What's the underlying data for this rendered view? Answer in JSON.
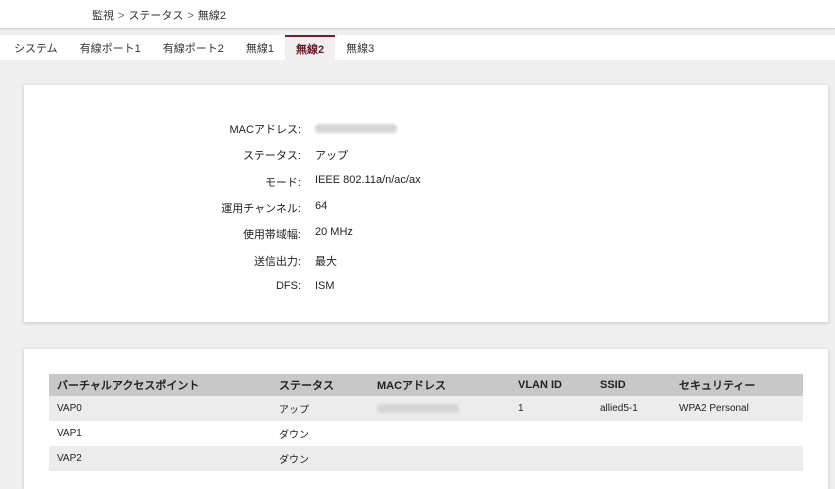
{
  "breadcrumb": {
    "items": [
      "監視",
      "ステータス",
      "無線2"
    ],
    "separator": ">"
  },
  "tabs": [
    {
      "label": "システム",
      "active": false
    },
    {
      "label": "有線ポート1",
      "active": false
    },
    {
      "label": "有線ポート2",
      "active": false
    },
    {
      "label": "無線1",
      "active": false
    },
    {
      "label": "無線2",
      "active": true
    },
    {
      "label": "無線3",
      "active": false
    }
  ],
  "info": {
    "mac_label": "MACアドレス:",
    "mac_value": "",
    "status_label": "ステータス:",
    "status_value": "アップ",
    "mode_label": "モード:",
    "mode_value": "IEEE 802.11a/n/ac/ax",
    "channel_label": "運用チャンネル:",
    "channel_value": "64",
    "bandwidth_label": "使用帯域幅:",
    "bandwidth_value": "20 MHz",
    "power_label": "送信出力:",
    "power_value": "最大",
    "dfs_label": "DFS:",
    "dfs_value": "ISM"
  },
  "vap_table": {
    "headers": [
      "バーチャルアクセスポイント",
      "ステータス",
      "MACアドレス",
      "VLAN ID",
      "SSID",
      "セキュリティー"
    ],
    "rows": [
      {
        "name": "VAP0",
        "status": "アップ",
        "mac": "",
        "vlan": "1",
        "ssid": "allied5-1",
        "security": "WPA2 Personal"
      },
      {
        "name": "VAP1",
        "status": "ダウン",
        "mac": "",
        "vlan": "",
        "ssid": "",
        "security": ""
      },
      {
        "name": "VAP2",
        "status": "ダウン",
        "mac": "",
        "vlan": "",
        "ssid": "",
        "security": ""
      }
    ]
  },
  "colors": {
    "active_tab": "#6b1a2a",
    "header_bg": "#c8c8c8",
    "page_bg": "#f0f0f0"
  }
}
